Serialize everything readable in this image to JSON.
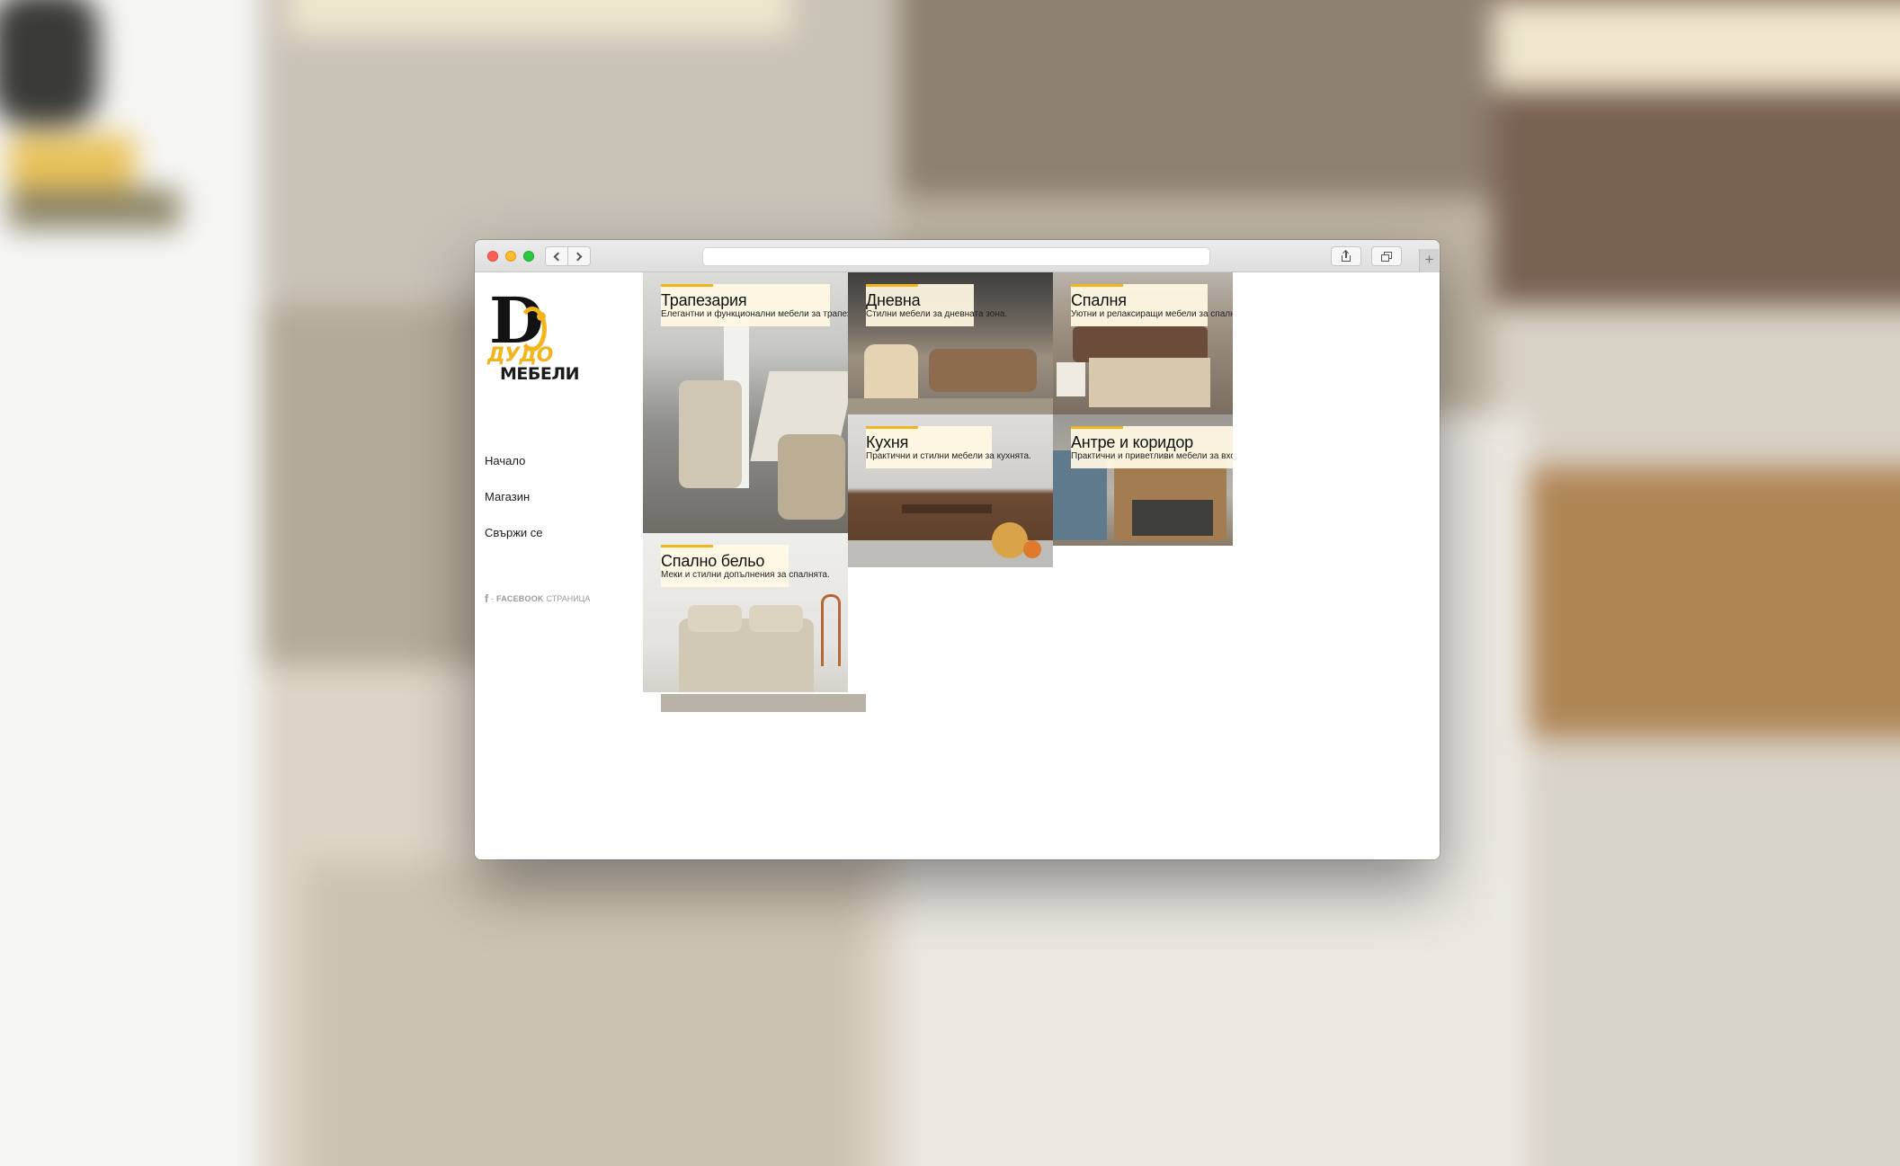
{
  "browser": {
    "url": ""
  },
  "site": {
    "logo": {
      "letter": "D",
      "line1": "ДУДО",
      "line2": "МЕБЕЛИ"
    },
    "menu": [
      "Начало",
      "Магазин",
      "Свържи се"
    ],
    "facebook": {
      "icon": "facebook-icon",
      "bold": "FACEBOOK",
      "label": "СТРАНИЦА",
      "prefix": "-"
    }
  },
  "categories": [
    {
      "title": "Трапезария",
      "subtitle": "Елегантни и функционални мебели за трапезарията."
    },
    {
      "title": "Дневна",
      "subtitle": "Стилни мебели за дневната зона."
    },
    {
      "title": "Спалня",
      "subtitle": "Уютни и релаксиращи мебели за спалнята."
    },
    {
      "title": "Кухня",
      "subtitle": "Практични и стилни мебели за кухнята."
    },
    {
      "title": "Антре и коридор",
      "subtitle": "Практични и приветливи мебели за входната зона."
    },
    {
      "title": "Спално бельо",
      "subtitle": "Меки и стилни допълнения за спалнята."
    }
  ],
  "colors": {
    "accent": "#f3b51e",
    "caption_bg": "#fff9e3",
    "text": "#111111"
  }
}
